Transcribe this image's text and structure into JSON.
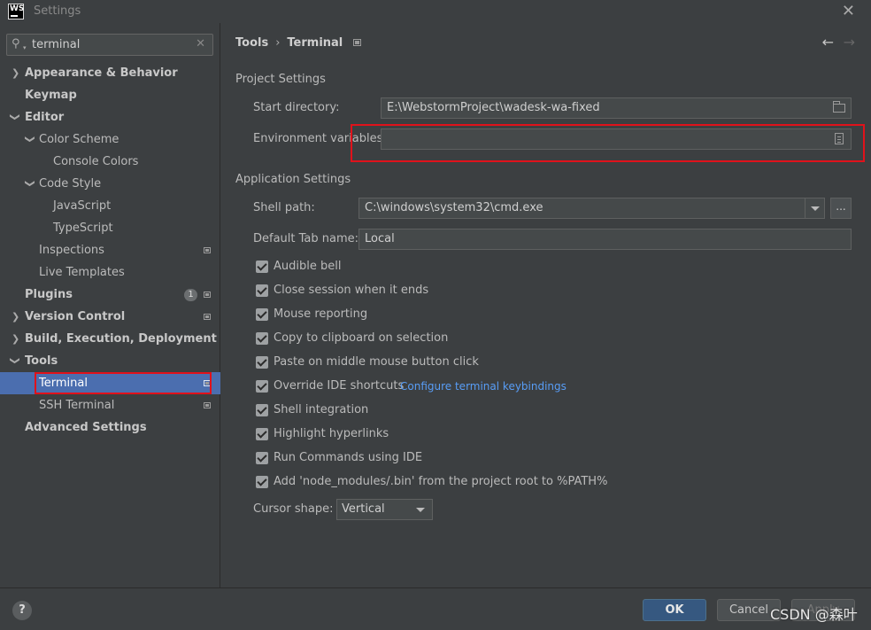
{
  "window": {
    "title": "Settings",
    "logo_text": "WS"
  },
  "search": {
    "value": "terminal"
  },
  "sidebar": {
    "items": [
      {
        "label": "Appearance & Behavior"
      },
      {
        "label": "Keymap"
      },
      {
        "label": "Editor"
      },
      {
        "label": "Color Scheme"
      },
      {
        "label": "Console Colors"
      },
      {
        "label": "Code Style"
      },
      {
        "label": "JavaScript"
      },
      {
        "label": "TypeScript"
      },
      {
        "label": "Inspections"
      },
      {
        "label": "Live Templates"
      },
      {
        "label": "Plugins",
        "badge": "1"
      },
      {
        "label": "Version Control"
      },
      {
        "label": "Build, Execution, Deployment"
      },
      {
        "label": "Tools"
      },
      {
        "label": "Terminal"
      },
      {
        "label": "SSH Terminal"
      },
      {
        "label": "Advanced Settings"
      }
    ]
  },
  "breadcrumb": {
    "parent": "Tools",
    "current": "Terminal"
  },
  "project_settings": {
    "title": "Project Settings",
    "start_directory_label": "Start directory:",
    "start_directory_value": "E:\\WebstormProject\\wadesk-wa-fixed",
    "env_vars_label": "Environment variables:",
    "env_vars_value": ""
  },
  "app_settings": {
    "title": "Application Settings",
    "shell_path_label": "Shell path:",
    "shell_path_value": "C:\\windows\\system32\\cmd.exe",
    "browse_label": "...",
    "default_tab_label": "Default Tab name:",
    "default_tab_value": "Local",
    "checkboxes": [
      {
        "label": "Audible bell",
        "checked": true
      },
      {
        "label": "Close session when it ends",
        "checked": true
      },
      {
        "label": "Mouse reporting",
        "checked": true
      },
      {
        "label": "Copy to clipboard on selection",
        "checked": true
      },
      {
        "label": "Paste on middle mouse button click",
        "checked": true
      },
      {
        "label": "Override IDE shortcuts",
        "checked": true
      },
      {
        "label": "Shell integration",
        "checked": true
      },
      {
        "label": "Highlight hyperlinks",
        "checked": true
      },
      {
        "label": "Run Commands using IDE",
        "checked": true
      },
      {
        "label": "Add 'node_modules/.bin' from the project root to %PATH%",
        "checked": true
      }
    ],
    "keybindings_link": "Configure terminal keybindings",
    "cursor_shape_label": "Cursor shape:",
    "cursor_shape_value": "Vertical"
  },
  "footer": {
    "help": "?",
    "ok": "OK",
    "cancel": "Cancel",
    "apply": "Apply",
    "watermark": "CSDN @森叶"
  },
  "colors": {
    "background": "#3c3f41",
    "selection": "#4b6eaf",
    "highlight_box": "#e0121b",
    "link": "#589df6",
    "ok_button": "#365880"
  }
}
